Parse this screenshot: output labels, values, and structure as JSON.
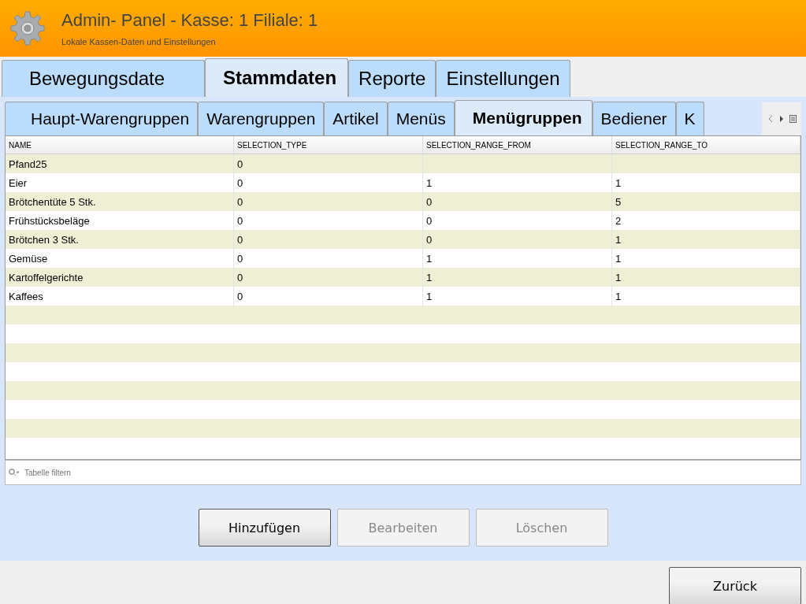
{
  "header": {
    "title": "Admin- Panel - Kasse: 1 Filiale: 1",
    "subtitle": "Lokale Kassen-Daten und Einstellungen"
  },
  "main_tabs": [
    {
      "label": "Bewegungsdate",
      "selected": false
    },
    {
      "label": "Stammdaten",
      "selected": true
    },
    {
      "label": "Reporte",
      "selected": false
    },
    {
      "label": "Einstellungen",
      "selected": false
    }
  ],
  "sub_tabs": [
    {
      "label": "Haupt-Warengruppen",
      "selected": false
    },
    {
      "label": "Warengruppen",
      "selected": false
    },
    {
      "label": "Artikel",
      "selected": false
    },
    {
      "label": "Menüs",
      "selected": false
    },
    {
      "label": "Menügruppen",
      "selected": true
    },
    {
      "label": "Bediener",
      "selected": false
    },
    {
      "label": "K",
      "selected": false
    }
  ],
  "table": {
    "columns": [
      "NAME",
      "SELECTION_TYPE",
      "SELECTION_RANGE_FROM",
      "SELECTION_RANGE_TO"
    ],
    "rows": [
      [
        "Pfand25",
        "0",
        "",
        ""
      ],
      [
        "Eier",
        "0",
        "1",
        "1"
      ],
      [
        "Brötchentüte 5 Stk.",
        "0",
        "0",
        "5"
      ],
      [
        "Frühstücksbeläge",
        "0",
        "0",
        "2"
      ],
      [
        "Brötchen 3 Stk.",
        "0",
        "0",
        "1"
      ],
      [
        "Gemüse",
        "0",
        "1",
        "1"
      ],
      [
        "Kartoffelgerichte",
        "0",
        "1",
        "1"
      ],
      [
        "Kaffees",
        "0",
        "1",
        "1"
      ]
    ]
  },
  "filter": {
    "placeholder": "Tabelle filtern"
  },
  "actions": [
    {
      "label": "Hinzufügen",
      "disabled": false
    },
    {
      "label": "Bearbeiten",
      "disabled": true
    },
    {
      "label": "Löschen",
      "disabled": true
    }
  ],
  "footer_button": "Zurück"
}
